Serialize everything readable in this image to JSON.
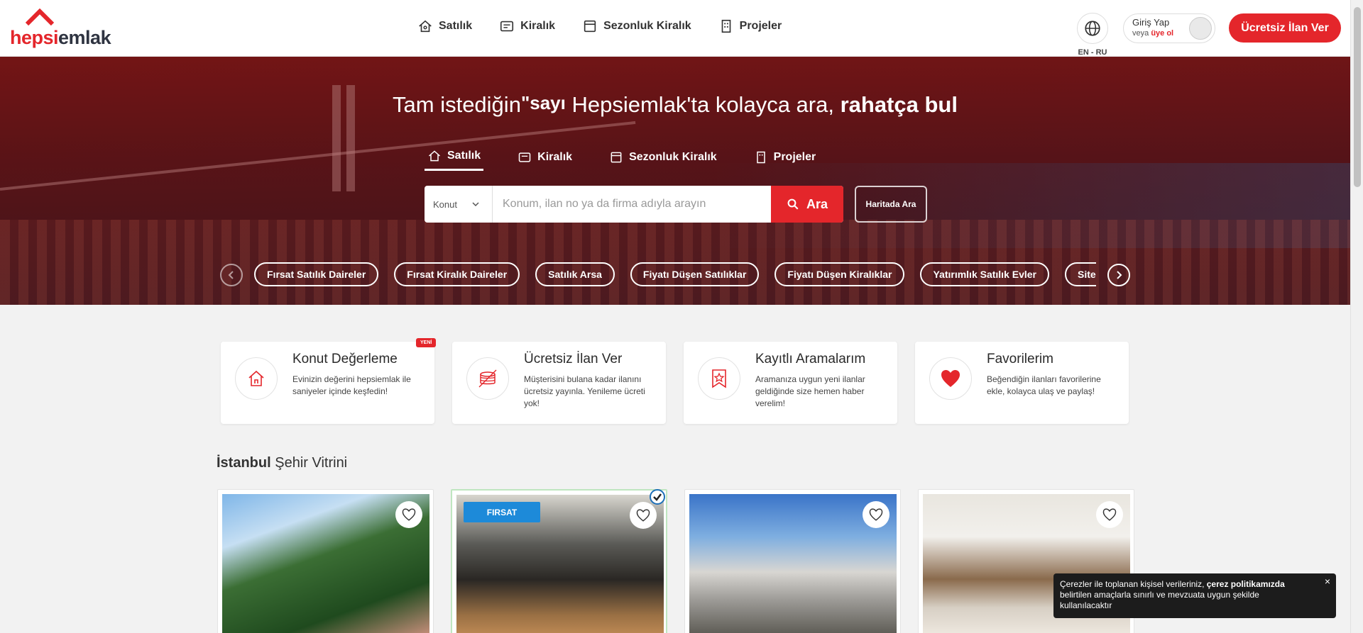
{
  "header": {
    "logo": {
      "part1": "hepsi",
      "part2": "emlak"
    },
    "nav": [
      {
        "label": "Satılık",
        "icon": "house-tag-icon"
      },
      {
        "label": "Kiralık",
        "icon": "key-list-icon"
      },
      {
        "label": "Sezonluk Kiralık",
        "icon": "calendar-icon"
      },
      {
        "label": "Projeler",
        "icon": "building-icon"
      }
    ],
    "lang_label": "EN - RU",
    "login": {
      "main": "Giriş Yap",
      "prefix": "veya",
      "register": "üye ol"
    },
    "cta": "Ücretsiz İlan Ver"
  },
  "hero": {
    "title_prefix": "Tam istediğin",
    "title_rotating": "\"sayı",
    "title_middle": " Hepsiemlak'ta kolayca ara, ",
    "title_bold": "rahatça bul",
    "tabs": [
      {
        "label": "Satılık",
        "active": true
      },
      {
        "label": "Kiralık",
        "active": false
      },
      {
        "label": "Sezonluk Kiralık",
        "active": false
      },
      {
        "label": "Projeler",
        "active": false
      }
    ],
    "search": {
      "type_value": "Konut",
      "placeholder": "Konum, ilan no ya da firma adıyla arayın",
      "button": "Ara",
      "map_button": "Haritada Ara"
    },
    "pills": [
      "Fırsat Satılık Daireler",
      "Fırsat Kiralık Daireler",
      "Satılık Arsa",
      "Fiyatı Düşen Satılıklar",
      "Fiyatı Düşen Kiralıklar",
      "Yatırımlık Satılık Evler",
      "Site İçi"
    ]
  },
  "features": [
    {
      "title": "Konut Değerleme",
      "text": "Evinizin değerini hepsiemlak ile saniyeler içinde keşfedin!",
      "badge": "YENİ",
      "icon": "house-value-icon"
    },
    {
      "title": "Ücretsiz İlan Ver",
      "text": "Müşterisini bulana kadar ilanını ücretsiz yayınla. Yenileme ücreti yok!",
      "icon": "coins-icon"
    },
    {
      "title": "Kayıtlı Aramalarım",
      "text": "Aramanıza uygun yeni ilanlar geldiğinde size hemen haber verelim!",
      "icon": "bookmark-star-icon"
    },
    {
      "title": "Favorilerim",
      "text": "Beğendiğin ilanları favorilerine ekle, kolayca ulaş ve paylaş!",
      "icon": "heart-icon"
    }
  ],
  "showcase": {
    "city": "İstanbul",
    "title": "Şehir Vitrini"
  },
  "listings": [
    {
      "label": ""
    },
    {
      "label": "FIRSAT"
    },
    {
      "label": ""
    },
    {
      "label": ""
    }
  ],
  "cookie": {
    "text1": "Çerezler ile toplanan kişisel verileriniz, ",
    "bold": "çerez politikamızda",
    "text2": " belirtilen amaçlarla sınırlı ve mevzuata uygun şekilde kullanılacaktır",
    "close": "×"
  },
  "colors": {
    "brand": "#e4262b",
    "featured_badge": "#1d8ad9"
  }
}
